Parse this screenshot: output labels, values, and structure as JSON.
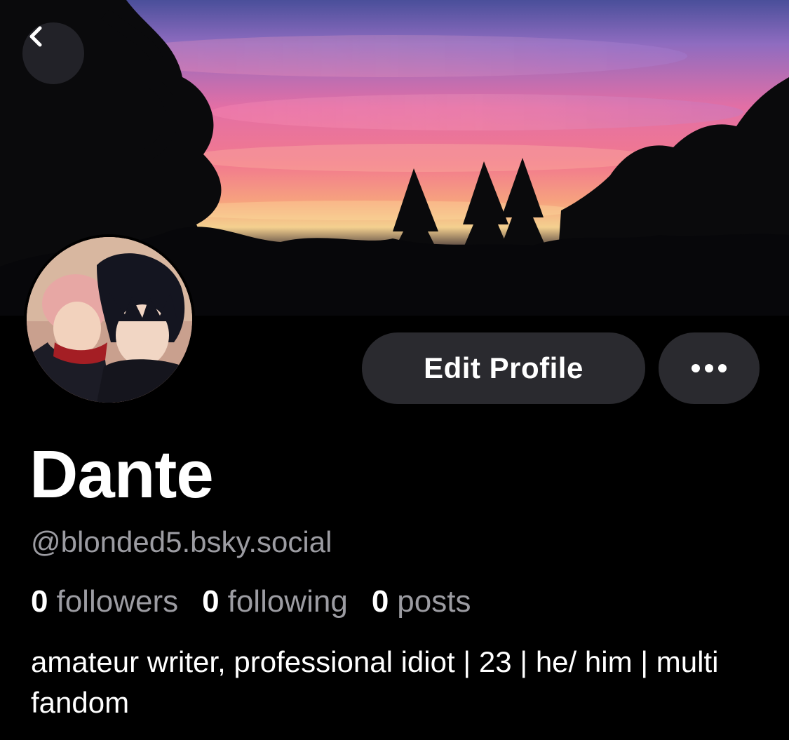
{
  "header": {
    "back_icon": "chevron-left-icon"
  },
  "profile": {
    "display_name": "Dante",
    "handle": "@blonded5.bsky.social",
    "bio": "amateur writer, professional idiot | 23 | he/ him | multi fandom",
    "stats": [
      {
        "count": "0",
        "label": "followers"
      },
      {
        "count": "0",
        "label": "following"
      },
      {
        "count": "0",
        "label": "posts"
      }
    ]
  },
  "actions": {
    "edit_profile_label": "Edit Profile",
    "more_icon": "ellipsis-icon"
  },
  "colors": {
    "background": "#000000",
    "button_bg": "#2a2a2f",
    "muted_text": "#9c9ca2",
    "text": "#ffffff"
  }
}
